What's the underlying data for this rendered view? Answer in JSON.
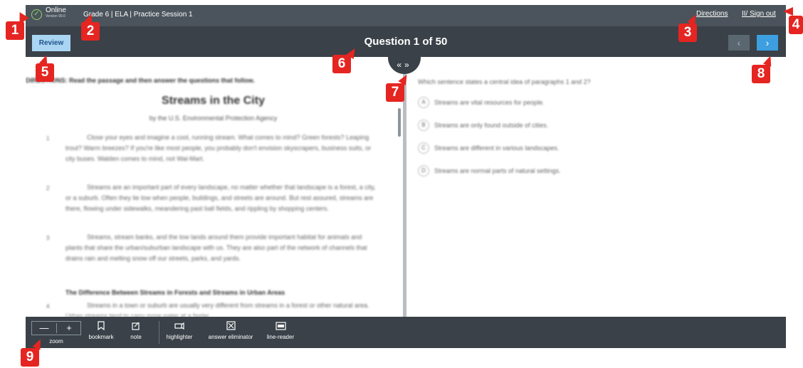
{
  "status": {
    "label": "Online",
    "version": "Version 99.0",
    "icon": "check-circle-icon"
  },
  "breadcrumb": "Grade 6 | ELA | Practice Session 1",
  "topbar": {
    "directions": "Directions",
    "signout": "II/ Sign out"
  },
  "nav": {
    "review": "Review",
    "question_title": "Question 1 of 50",
    "prev": "‹",
    "next": "›",
    "splitter": "«»"
  },
  "passage": {
    "instructions": "DIRECTIONS: Read the passage and then answer the questions that follow.",
    "title": "Streams in the City",
    "byline": "by the U.S. Environmental Protection Agency",
    "paragraphs": [
      {
        "num": "1",
        "text": "Close your eyes and imagine a cool, running stream. What comes to mind? Green forests? Leaping trout? Warm breezes? If you're like most people, you probably don't envision skyscrapers, business suits, or city buses. Walden comes to mind, not Wal-Mart."
      },
      {
        "num": "2",
        "text": "Streams are an important part of every landscape, no matter whether that landscape is a forest, a city, or a suburb. Often they lie low when people, buildings, and streets are around. But rest assured, streams are there, flowing under sidewalks, meandering past ball fields, and rippling by shopping centers."
      },
      {
        "num": "3",
        "text": "Streams, stream banks, and the low lands around them provide important habitat for animals and plants that share the urban/suburban landscape with us. They are also part of the network of channels that drains rain and melting snow off our streets, parks, and yards."
      },
      {
        "num": "4",
        "text": "Streams in a town or suburb are usually very different from streams in a forest or other natural area. Urban streams tend to carry more water at a faster"
      }
    ],
    "subheading": "The Difference Between Streams in Forests and Streams in Urban Areas"
  },
  "question": {
    "stem": "Which sentence states a central idea of paragraphs 1 and 2?",
    "options": [
      {
        "letter": "A",
        "text": "Streams are vital resources for people."
      },
      {
        "letter": "B",
        "text": "Streams are only found outside of cities."
      },
      {
        "letter": "C",
        "text": "Streams are different in various landscapes."
      },
      {
        "letter": "D",
        "text": "Streams are normal parts of natural settings."
      }
    ]
  },
  "tools": {
    "zoom_label": "zoom",
    "zoom_out": "—",
    "zoom_in": "+",
    "bookmark": "bookmark",
    "note": "note",
    "highlighter": "highlighter",
    "answer_eliminator": "answer eliminator",
    "line_reader": "line-reader"
  },
  "callouts": [
    "1",
    "2",
    "3",
    "4",
    "5",
    "6",
    "7",
    "8",
    "9"
  ],
  "colors": {
    "callout": "#e52521",
    "next_button": "#3d9fe0",
    "review_button": "#a9d5f3",
    "bar": "#3a4148"
  }
}
